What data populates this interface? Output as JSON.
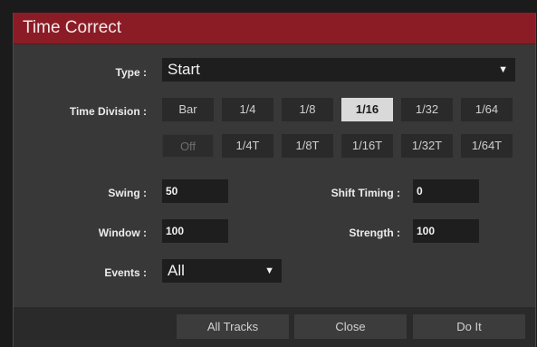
{
  "dialog": {
    "title": "Time Correct"
  },
  "type": {
    "label": "Type :",
    "value": "Start"
  },
  "time_division": {
    "label": "Time Division :",
    "row1": [
      "Bar",
      "1/4",
      "1/8",
      "1/16",
      "1/32",
      "1/64"
    ],
    "row2": [
      "Off",
      "1/4T",
      "1/8T",
      "1/16T",
      "1/32T",
      "1/64T"
    ],
    "selected": "1/16"
  },
  "swing": {
    "label": "Swing :",
    "value": "50"
  },
  "shift_timing": {
    "label": "Shift Timing :",
    "value": "0"
  },
  "window": {
    "label": "Window :",
    "value": "100"
  },
  "strength": {
    "label": "Strength :",
    "value": "100"
  },
  "events": {
    "label": "Events :",
    "value": "All"
  },
  "footer": {
    "all_tracks": "All Tracks",
    "close": "Close",
    "do_it": "Do It"
  },
  "icons": {
    "dropdown": "caret-down-icon"
  },
  "colors": {
    "titlebar": "#8b1c26",
    "background": "#383838",
    "selected": "#d9d9d9"
  }
}
